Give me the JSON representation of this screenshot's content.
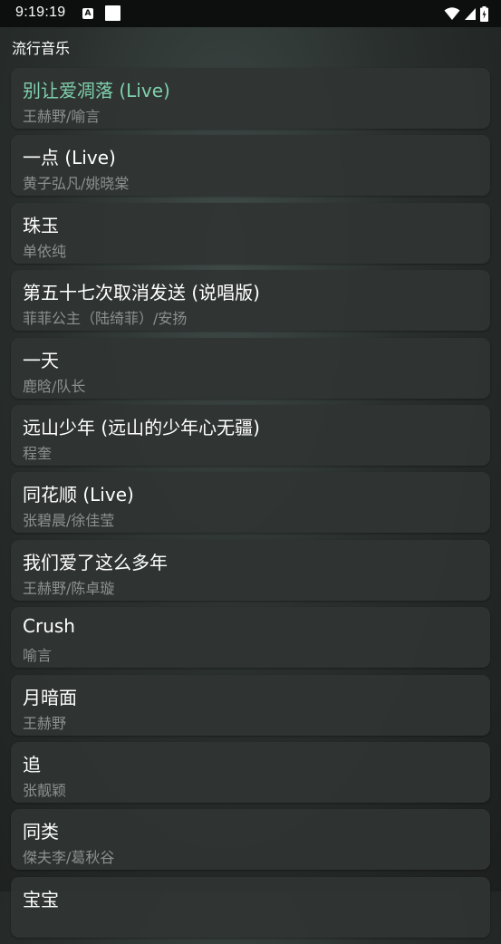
{
  "status_bar": {
    "time": "9:19:19",
    "a_icon_letter": "A"
  },
  "page": {
    "title": "流行音乐"
  },
  "songs": [
    {
      "title": "别让爱凋落 (Live)",
      "artist": "王赫野/喻言",
      "active": true
    },
    {
      "title": "一点 (Live)",
      "artist": "黄子弘凡/姚晓棠",
      "active": false
    },
    {
      "title": "珠玉",
      "artist": "单依纯",
      "active": false
    },
    {
      "title": "第五十七次取消发送 (说唱版)",
      "artist": "菲菲公主（陆绮菲）/安扬",
      "active": false
    },
    {
      "title": "一天",
      "artist": "鹿晗/队长",
      "active": false
    },
    {
      "title": "远山少年 (远山的少年心无疆)",
      "artist": "程奎",
      "active": false
    },
    {
      "title": "同花顺 (Live)",
      "artist": "张碧晨/徐佳莹",
      "active": false
    },
    {
      "title": "我们爱了这么多年",
      "artist": "王赫野/陈卓璇",
      "active": false
    },
    {
      "title": "Crush",
      "artist": "喻言",
      "active": false
    },
    {
      "title": "月暗面",
      "artist": "王赫野",
      "active": false
    },
    {
      "title": "追",
      "artist": "张靓颖",
      "active": false
    },
    {
      "title": "同类",
      "artist": "傑夫李/葛秋谷",
      "active": false
    },
    {
      "title": "宝宝",
      "artist": "",
      "active": false
    }
  ],
  "colors": {
    "active_title": "#7fd0ac",
    "artist_text": "#8c918f",
    "card_background": "#303433",
    "status_bar": "#0d0f0e"
  }
}
